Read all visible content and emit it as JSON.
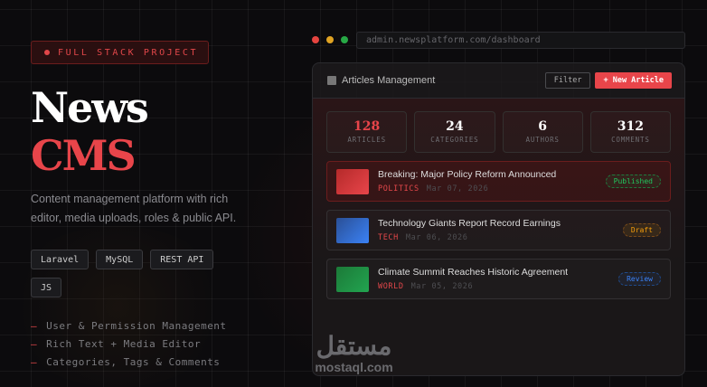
{
  "badge": "FULL STACK PROJECT",
  "title_line1": "News",
  "title_line2": "CMS",
  "description": "Content management platform with rich editor, media uploads, roles & public API.",
  "tags": [
    "Laravel",
    "MySQL",
    "REST API",
    "JS"
  ],
  "features": [
    "User & Permission Management",
    "Rich Text + Media Editor",
    "Categories, Tags & Comments"
  ],
  "browser": {
    "url": "admin.newsplatform.com/dashboard"
  },
  "panel": {
    "title": "Articles Management",
    "filter_label": "Filter",
    "new_label": "+ New Article",
    "stats": [
      {
        "value": "128",
        "label": "ARTICLES"
      },
      {
        "value": "24",
        "label": "CATEGORIES"
      },
      {
        "value": "6",
        "label": "AUTHORS"
      },
      {
        "value": "312",
        "label": "COMMENTS"
      }
    ],
    "articles": [
      {
        "title": "Breaking: Major Policy Reform Announced",
        "category": "POLITICS",
        "date": "Mar 07, 2026",
        "status": "Published"
      },
      {
        "title": "Technology Giants Report Record Earnings",
        "category": "TECH",
        "date": "Mar 06, 2026",
        "status": "Draft"
      },
      {
        "title": "Climate Summit Reaches Historic Agreement",
        "category": "WORLD",
        "date": "Mar 05, 2026",
        "status": "Review"
      }
    ]
  },
  "watermark": {
    "arabic": "مستقل",
    "latin": "mostaql.com"
  },
  "colors": {
    "accent": "#e8454a",
    "published": "#22c55e",
    "draft": "#f59e0b",
    "review": "#3b82f6"
  }
}
